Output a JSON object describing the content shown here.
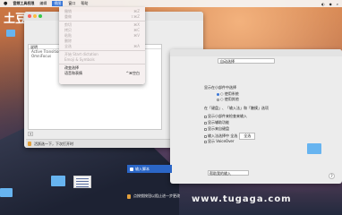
{
  "menubar": {
    "app": "音频工具权限",
    "items": [
      "编辑",
      "视图",
      "窗口",
      "帮助"
    ],
    "active": "视图",
    "right": [
      "",
      "",
      ""
    ]
  },
  "logo": "土豆",
  "window": {
    "list_header": "说明",
    "rows": [
      "Active Transition",
      "OmniFocus"
    ],
    "add": "+",
    "bottom_text": "活跃选一下，下次打开时",
    "help": "?"
  },
  "menu": {
    "items": [
      {
        "label": "撤销",
        "shortcut": "⌘Z",
        "enabled": false
      },
      {
        "label": "重做",
        "shortcut": "⇧⌘Z",
        "enabled": false
      },
      {
        "sep": true
      },
      {
        "label": "剪切",
        "shortcut": "⌘X",
        "enabled": false
      },
      {
        "label": "拷贝",
        "shortcut": "⌘C",
        "enabled": false
      },
      {
        "label": "粘贴",
        "shortcut": "⌘V",
        "enabled": false
      },
      {
        "label": "删除",
        "shortcut": "",
        "enabled": false
      },
      {
        "label": "全选",
        "shortcut": "⌘A",
        "enabled": false
      },
      {
        "sep": true
      },
      {
        "label": "开始 Start dictation",
        "shortcut": "",
        "enabled": false
      },
      {
        "label": "Emoji & Symbols",
        "shortcut": "",
        "enabled": false
      },
      {
        "sep": true
      },
      {
        "label": "改变选择",
        "shortcut": "",
        "enabled": true
      },
      {
        "label": "语音和表情",
        "shortcut": "^⌘空白",
        "enabled": true
      }
    ]
  },
  "prefs": {
    "select": "自动选择",
    "lines": [
      "显示在小部件中选择",
      "○ 使用系统",
      "○ 使用其他",
      "在「键盘」、「输入法」和「触摸」选项",
      "显示小部件来检查来输入",
      "显示辅助功能",
      "显示来自键盘",
      "输入法选择中 全选"
    ],
    "popup_label": "全选",
    "voiceover": "显示 VoiceOver",
    "bar": "帮助我的输入",
    "help": "?"
  },
  "sidebar": {
    "selected": "输入脚本"
  },
  "bottom": {
    "lock_text": "点按锁按钮以阻止进一步更改"
  },
  "watermark": "www.tugaga.com"
}
